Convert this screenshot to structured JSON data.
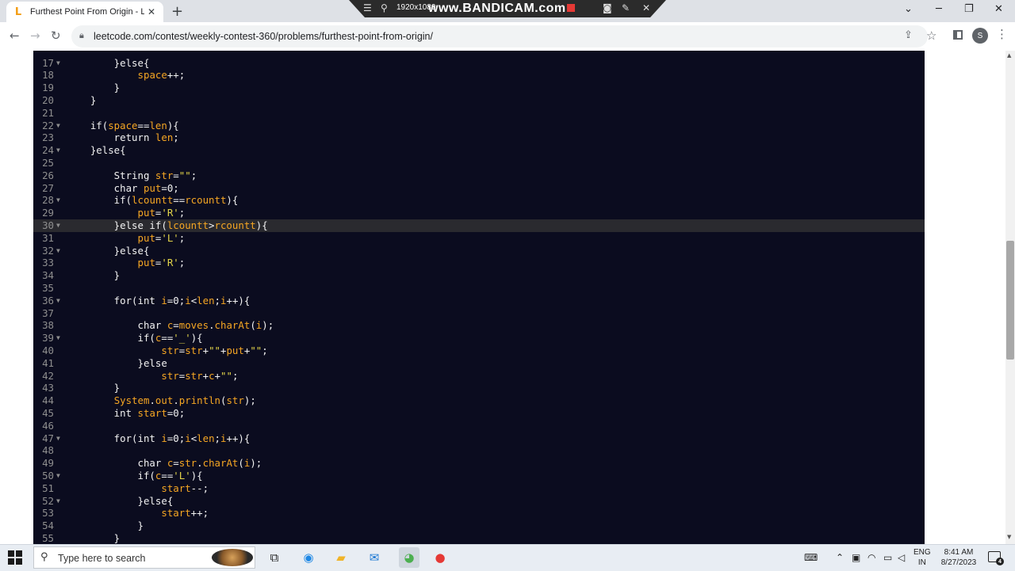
{
  "browser": {
    "tab_title": "Furthest Point From Origin - LeetCode",
    "url": "leetcode.com/contest/weekly-contest-360/problems/furthest-point-from-origin/",
    "profile_initial": "S"
  },
  "recorder": {
    "resolution": "1920x1080",
    "watermark": "www.BANDICAM.com"
  },
  "editor": {
    "highlighted_line": 30,
    "lines": [
      {
        "n": "17",
        "fold": true,
        "html": "        }<span class=\"k\">else</span>{"
      },
      {
        "n": "18",
        "fold": false,
        "html": "            <span class=\"v\">space</span>++;"
      },
      {
        "n": "19",
        "fold": false,
        "html": "        }"
      },
      {
        "n": "20",
        "fold": false,
        "html": "    }"
      },
      {
        "n": "21",
        "fold": false,
        "html": ""
      },
      {
        "n": "22",
        "fold": true,
        "html": "    if(<span class=\"v\">space</span>==<span class=\"v\">len</span>){"
      },
      {
        "n": "23",
        "fold": false,
        "html": "        return <span class=\"v\">len</span>;"
      },
      {
        "n": "24",
        "fold": true,
        "html": "    }else{"
      },
      {
        "n": "25",
        "fold": false,
        "html": ""
      },
      {
        "n": "26",
        "fold": false,
        "html": "        String <span class=\"v\">str</span>=<span class=\"s\">\"\"</span>;"
      },
      {
        "n": "27",
        "fold": false,
        "html": "        char <span class=\"v\">put</span>=0;"
      },
      {
        "n": "28",
        "fold": true,
        "html": "        if(<span class=\"v\">lcountt</span>==<span class=\"v\">rcountt</span>){"
      },
      {
        "n": "29",
        "fold": false,
        "html": "            <span class=\"v\">put</span>=<span class=\"s\">'R'</span>;"
      },
      {
        "n": "30",
        "fold": true,
        "html": "        }else if(<span class=\"v\">lcountt</span>&gt;<span class=\"v\">rcountt</span>){"
      },
      {
        "n": "31",
        "fold": false,
        "html": "            <span class=\"v\">put</span>=<span class=\"s\">'L'</span>;"
      },
      {
        "n": "32",
        "fold": true,
        "html": "        }else{"
      },
      {
        "n": "33",
        "fold": false,
        "html": "            <span class=\"v\">put</span>=<span class=\"s\">'R'</span>;"
      },
      {
        "n": "34",
        "fold": false,
        "html": "        }"
      },
      {
        "n": "35",
        "fold": false,
        "html": ""
      },
      {
        "n": "36",
        "fold": true,
        "html": "        for(int <span class=\"v\">i</span>=0;<span class=\"v\">i</span>&lt;<span class=\"v\">len</span>;<span class=\"v\">i</span>++){"
      },
      {
        "n": "37",
        "fold": false,
        "html": ""
      },
      {
        "n": "38",
        "fold": false,
        "html": "            char <span class=\"v\">c</span>=<span class=\"v\">moves</span>.<span class=\"v\">charAt</span>(<span class=\"v\">i</span>);"
      },
      {
        "n": "39",
        "fold": true,
        "html": "            if(<span class=\"v\">c</span>==<span class=\"s\">'_'</span>){"
      },
      {
        "n": "40",
        "fold": false,
        "html": "                <span class=\"v\">str</span>=<span class=\"v\">str</span>+<span class=\"s\">\"\"</span>+<span class=\"v\">put</span>+<span class=\"s\">\"\"</span>;"
      },
      {
        "n": "41",
        "fold": false,
        "html": "            }else"
      },
      {
        "n": "42",
        "fold": false,
        "html": "                <span class=\"v\">str</span>=<span class=\"v\">str</span>+<span class=\"v\">c</span>+<span class=\"s\">\"\"</span>;"
      },
      {
        "n": "43",
        "fold": false,
        "html": "        }"
      },
      {
        "n": "44",
        "fold": false,
        "html": "        <span class=\"v\">System</span>.<span class=\"v\">out</span>.<span class=\"v\">println</span>(<span class=\"v\">str</span>);"
      },
      {
        "n": "45",
        "fold": false,
        "html": "        int <span class=\"v\">start</span>=0;"
      },
      {
        "n": "46",
        "fold": false,
        "html": ""
      },
      {
        "n": "47",
        "fold": true,
        "html": "        for(int <span class=\"v\">i</span>=0;<span class=\"v\">i</span>&lt;<span class=\"v\">len</span>;<span class=\"v\">i</span>++){"
      },
      {
        "n": "48",
        "fold": false,
        "html": ""
      },
      {
        "n": "49",
        "fold": false,
        "html": "            char <span class=\"v\">c</span>=<span class=\"v\">str</span>.<span class=\"v\">charAt</span>(<span class=\"v\">i</span>);"
      },
      {
        "n": "50",
        "fold": true,
        "html": "            if(<span class=\"v\">c</span>==<span class=\"s\">'L'</span>){"
      },
      {
        "n": "51",
        "fold": false,
        "html": "                <span class=\"v\">start</span>--;"
      },
      {
        "n": "52",
        "fold": true,
        "html": "            }else{"
      },
      {
        "n": "53",
        "fold": false,
        "html": "                <span class=\"v\">start</span>++;"
      },
      {
        "n": "54",
        "fold": false,
        "html": "            }"
      },
      {
        "n": "55",
        "fold": false,
        "html": "        }"
      }
    ]
  },
  "taskbar": {
    "search_placeholder": "Type here to search",
    "lang_top": "ENG",
    "lang_bottom": "IN",
    "time": "8:41 AM",
    "date": "8/27/2023",
    "notif_count": "4"
  },
  "colors": {
    "editor_bg": "#0b0c1f",
    "variable": "#f5a623",
    "string": "#e6d74a"
  },
  "icons": [
    "leetcode-icon",
    "close-icon",
    "plus-icon",
    "back-icon",
    "forward-icon",
    "reload-icon",
    "lock-icon",
    "share-icon",
    "star-icon",
    "side-panel-icon",
    "menu-icon",
    "windows-icon",
    "search-icon",
    "task-view-icon",
    "edge-icon",
    "folder-icon",
    "mail-icon",
    "chrome-icon",
    "record-icon"
  ]
}
